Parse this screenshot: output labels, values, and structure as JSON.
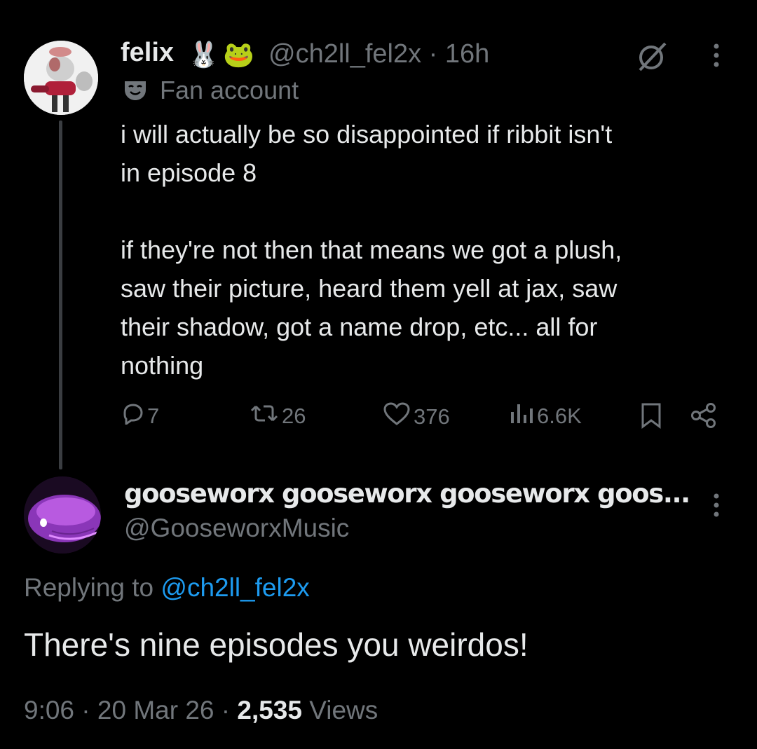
{
  "parent": {
    "display_name": "felix",
    "emojis": [
      "🐰",
      "🐸"
    ],
    "handle_time": "@ch2ll_fel2x · 16h",
    "label": "Fan account",
    "text": "i will actually be so disappointed if ribbit isn't\nin episode 8\n\nif they're not then that means we got a plush,\nsaw their picture, heard them yell at jax, saw\ntheir shadow, got a name drop, etc... all for\nnothing",
    "actions": {
      "replies": "7",
      "reposts": "26",
      "likes": "376",
      "views": "6.6K"
    }
  },
  "reply": {
    "display_name": "gooseworx gooseworx gooseworx goos...",
    "handle": "@GooseworxMusic",
    "replying_prefix": "Replying to ",
    "replying_to": "@ch2ll_fel2x",
    "text": "There's nine episodes you weirdos!",
    "time": "9:06 · 20 Mar 26 · ",
    "views_count": "2,535",
    "views_label": " Views"
  },
  "colors": {
    "background": "#000000",
    "text": "#e7e9ea",
    "muted": "#71767b",
    "link": "#1d9bf0"
  },
  "icons": [
    "grok-icon",
    "more-icon",
    "fan-account-icon",
    "reply-icon",
    "repost-icon",
    "like-icon",
    "views-icon",
    "bookmark-icon",
    "share-icon"
  ]
}
